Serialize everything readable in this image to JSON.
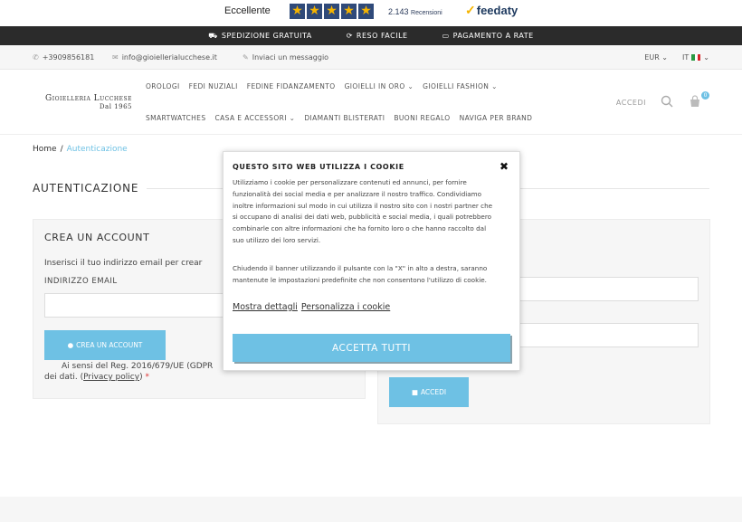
{
  "rating": {
    "label": "Eccellente",
    "stars": 5,
    "count": "2.143",
    "count_label": "Recensioni",
    "brand": "feedaty"
  },
  "promo": [
    {
      "icon": "truck-icon",
      "label": "SPEDIZIONE GRATUITA"
    },
    {
      "icon": "refresh-icon",
      "label": "RESO FACILE"
    },
    {
      "icon": "card-icon",
      "label": "PAGAMENTO A RATE"
    }
  ],
  "contact": {
    "phone": "+3909856181",
    "email": "info@gioiellerialucchese.it",
    "message": "Inviaci un messaggio",
    "currency": "EUR",
    "language": "IT"
  },
  "header": {
    "logo_main": "Gioielleria Lucchese",
    "logo_sub": "Dal 1965",
    "nav_row1": [
      "OROLOGI",
      "FEDI NUZIALI",
      "FEDINE FIDANZAMENTO",
      "GIOIELLI IN ORO",
      "GIOIELLI FASHION"
    ],
    "nav_row2": [
      "SMARTWATCHES",
      "CASA E ACCESSORI",
      "DIAMANTI BLISTERATI",
      "BUONI REGALO",
      "NAVIGA PER BRAND"
    ],
    "accedi": "ACCEDI",
    "cart_count": "0"
  },
  "breadcrumb": {
    "home": "Home",
    "sep": "/",
    "current": "Autenticazione"
  },
  "page": {
    "title": "AUTENTICAZIONE"
  },
  "create_account": {
    "heading": "CREA UN ACCOUNT",
    "intro": "Inserisci il tuo indirizzo email per crear",
    "email_label": "INDIRIZZO EMAIL",
    "button": "CREA UN ACCOUNT",
    "gdpr_line1": "Ai sensi del Reg. 2016/679/UE (GDPR",
    "gdpr_line2_prefix": "dei dati. (",
    "privacy_link": "Privacy policy",
    "gdpr_line2_suffix": ")",
    "required_mark": "*"
  },
  "login": {
    "button": "ACCEDI"
  },
  "cookie_modal": {
    "title": "QUESTO SITO WEB UTILIZZA I COOKIE",
    "close": "✖",
    "paragraph1": "Utilizziamo i cookie per personalizzare contenuti ed annunci, per fornire funzionalità dei social media e per analizzare il nostro traffico. Condividiamo inoltre informazioni sul modo in cui utilizza il nostro sito con i nostri partner che si occupano di analisi dei dati web, pubblicità e social media, i quali potrebbero combinarle con altre informazioni che ha fornito loro o che hanno raccolto dal suo utilizzo dei loro servizi.",
    "paragraph2": "Chiudendo il banner utilizzando il pulsante con la \"X\" in alto a destra, saranno mantenute le impostazioni predefinite che non consentono l'utilizzo di cookie.",
    "link_details": "Mostra dettagli",
    "link_customize": "Personalizza i cookie",
    "accept": "ACCETTA TUTTI"
  },
  "colors": {
    "accent": "#6ec1e4",
    "dark_bar": "#2b2b2b",
    "panel_bg": "#f6f6f6"
  }
}
